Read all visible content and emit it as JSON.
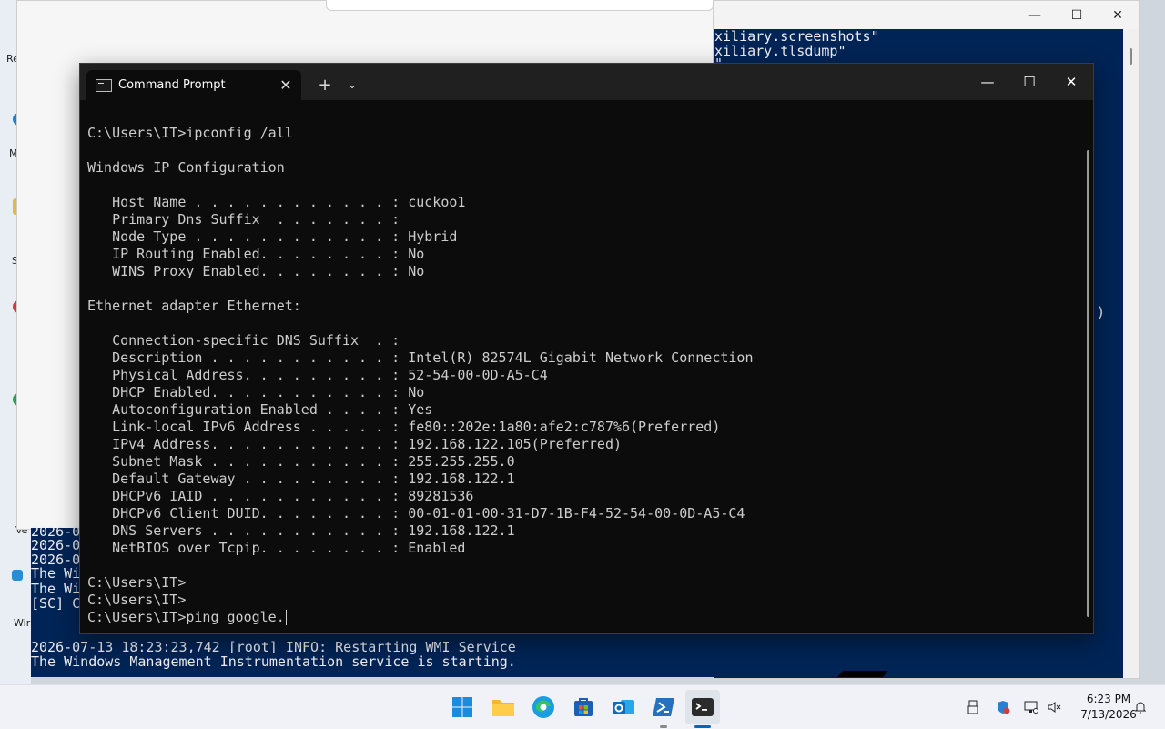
{
  "desktop": {
    "icon_labels": [
      "Re",
      "M",
      "S",
      "Ve",
      "Wir"
    ]
  },
  "powershell_window": {
    "lines": [
      "xiliary.screenshots\"",
      "xiliary.tlsdump\"",
      "\"",
      "))"
    ],
    "minimize_icon": "minimize-icon",
    "maximize_icon": "maximize-icon",
    "close_icon": "close-icon"
  },
  "bottom_console": {
    "lines": [
      "2026-0",
      "2026-0",
      "2026-0",
      "The Wi",
      "The Wi",
      "[SC] ChangeServiceConfig SUCCESS",
      "2026-07-13 18:23:23,742 [root] INFO: Restarting WMI Service",
      "The Windows Management Instrumentation service is starting."
    ]
  },
  "cmd_window": {
    "tab_title": "Command Prompt",
    "tab_close_glyph": "✕",
    "new_tab_glyph": "+",
    "dropdown_glyph": "⌄",
    "minimize_glyph": "—",
    "maximize_glyph": "☐",
    "close_glyph": "✕",
    "lines": [
      "C:\\Users\\IT>ipconfig /all",
      "",
      "Windows IP Configuration",
      "",
      "   Host Name . . . . . . . . . . . . : cuckoo1",
      "   Primary Dns Suffix  . . . . . . . :",
      "   Node Type . . . . . . . . . . . . : Hybrid",
      "   IP Routing Enabled. . . . . . . . : No",
      "   WINS Proxy Enabled. . . . . . . . : No",
      "",
      "Ethernet adapter Ethernet:",
      "",
      "   Connection-specific DNS Suffix  . :",
      "   Description . . . . . . . . . . . : Intel(R) 82574L Gigabit Network Connection",
      "   Physical Address. . . . . . . . . : 52-54-00-0D-A5-C4",
      "   DHCP Enabled. . . . . . . . . . . : No",
      "   Autoconfiguration Enabled . . . . : Yes",
      "   Link-local IPv6 Address . . . . . : fe80::202e:1a80:afe2:c787%6(Preferred)",
      "   IPv4 Address. . . . . . . . . . . : 192.168.122.105(Preferred)",
      "   Subnet Mask . . . . . . . . . . . : 255.255.255.0",
      "   Default Gateway . . . . . . . . . : 192.168.122.1",
      "   DHCPv6 IAID . . . . . . . . . . . : 89281536",
      "   DHCPv6 Client DUID. . . . . . . . : 00-01-01-00-31-D7-1B-F4-52-54-00-0D-A5-C4",
      "   DNS Servers . . . . . . . . . . . : 192.168.122.1",
      "   NetBIOS over Tcpip. . . . . . . . : Enabled",
      "",
      "C:\\Users\\IT>",
      "C:\\Users\\IT>",
      "C:\\Users\\IT>ping google."
    ]
  },
  "taskbar": {
    "apps": [
      {
        "name": "start-button",
        "icon": "windows-logo-icon",
        "active": false
      },
      {
        "name": "file-explorer",
        "icon": "folder-icon",
        "active": false
      },
      {
        "name": "edge",
        "icon": "edge-icon",
        "active": false
      },
      {
        "name": "microsoft-store",
        "icon": "store-icon",
        "active": false
      },
      {
        "name": "outlook",
        "icon": "outlook-icon",
        "active": false
      },
      {
        "name": "powershell",
        "icon": "powershell-icon",
        "active": true
      },
      {
        "name": "terminal",
        "icon": "terminal-icon",
        "active": true
      }
    ],
    "clock_time": "6:23 PM",
    "clock_date": "7/13/2026",
    "tray_icons": [
      "usb-icon",
      "security-icon",
      "network-icon",
      "volume-muted-icon",
      "notification-icon"
    ],
    "colors": {
      "accent": "#0067c0",
      "taskbar_bg": "#f0f2f7"
    }
  }
}
